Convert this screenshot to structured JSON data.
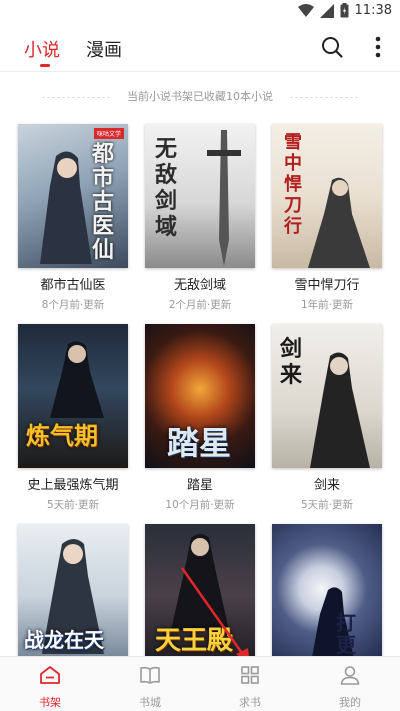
{
  "status_bar": {
    "time": "11:38",
    "icons": [
      "wifi-icon",
      "signal-icon",
      "battery-icon"
    ]
  },
  "header": {
    "tabs": [
      {
        "label": "小说",
        "active": true
      },
      {
        "label": "漫画",
        "active": false
      }
    ],
    "search_icon": "search-icon",
    "more_icon": "more-vertical-icon"
  },
  "notice": "当前小说书架已收藏10本小说",
  "books": [
    {
      "title": "都市古仙医",
      "meta": "8个月前·更新",
      "cover_text": "都市古医仙",
      "badge": "咪咕文学"
    },
    {
      "title": "无敌剑域",
      "meta": "2个月前·更新",
      "cover_text": "无敌剑域",
      "badge": ""
    },
    {
      "title": "雪中悍刀行",
      "meta": "1年前·更新",
      "cover_text": "雪中悍刀行",
      "badge": ""
    },
    {
      "title": "史上最强炼气期",
      "meta": "5天前·更新",
      "cover_text": "炼气期",
      "badge": ""
    },
    {
      "title": "踏星",
      "meta": "10个月前·更新",
      "cover_text": "踏星",
      "badge": ""
    },
    {
      "title": "剑来",
      "meta": "5天前·更新",
      "cover_text": "剑来",
      "badge": ""
    },
    {
      "title": "",
      "meta": "",
      "cover_text": "战龙在天",
      "badge": ""
    },
    {
      "title": "",
      "meta": "",
      "cover_text": "天王殿",
      "badge": ""
    },
    {
      "title": "",
      "meta": "",
      "cover_text": "打更人",
      "badge": ""
    }
  ],
  "bottom_nav": [
    {
      "label": "书架",
      "icon": "bookshelf-icon",
      "active": true
    },
    {
      "label": "书城",
      "icon": "book-open-icon",
      "active": false
    },
    {
      "label": "求书",
      "icon": "grid-icon",
      "active": false
    },
    {
      "label": "我的",
      "icon": "user-icon",
      "active": false
    }
  ],
  "colors": {
    "accent": "#e0272b",
    "muted": "#9a9a9a"
  }
}
